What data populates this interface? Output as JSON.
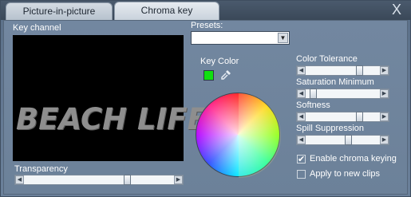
{
  "tabs": [
    {
      "label": "Picture-in-picture"
    },
    {
      "label": "Chroma key"
    }
  ],
  "close_label": "X",
  "key_channel": {
    "label": "Key channel",
    "preview_text": "BEACH LIFE"
  },
  "transparency": {
    "label": "Transparency",
    "value_fraction": 0.7
  },
  "presets": {
    "label": "Presets:",
    "value": ""
  },
  "key_color": {
    "label": "Key Color",
    "color": "#10e010"
  },
  "sliders": {
    "color_tolerance": {
      "label": "Color Tolerance",
      "value_fraction": 0.75
    },
    "saturation_minimum": {
      "label": "Saturation Minimum",
      "value_fraction": 0.05
    },
    "softness": {
      "label": "Softness",
      "value_fraction": 0.75
    },
    "spill_suppression": {
      "label": "Spill Suppression",
      "value_fraction": 0.58
    }
  },
  "checkboxes": {
    "enable_chroma": {
      "label": "Enable chroma keying",
      "checked": true
    },
    "apply_new": {
      "label": "Apply to new clips",
      "checked": false
    }
  }
}
